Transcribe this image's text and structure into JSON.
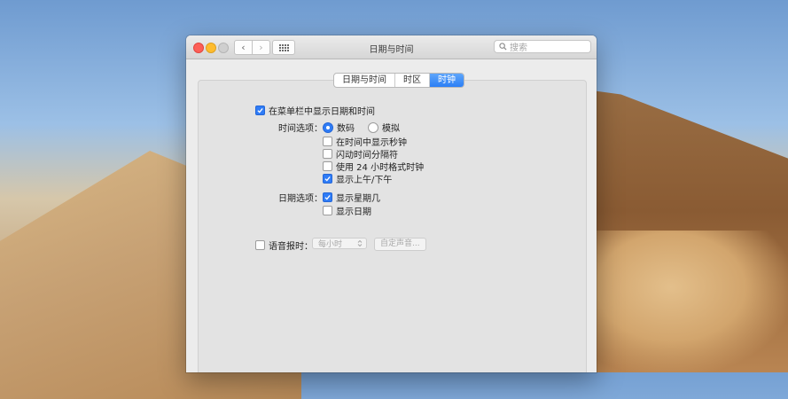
{
  "window": {
    "title": "日期与时间",
    "search_placeholder": "搜索",
    "back_glyph": "‹",
    "forward_glyph": "›"
  },
  "tabs": [
    {
      "label": "日期与时间",
      "active": false
    },
    {
      "label": "时区",
      "active": false
    },
    {
      "label": "时钟",
      "active": true
    }
  ],
  "clock": {
    "show_in_menubar": {
      "label": "在菜单栏中显示日期和时间",
      "checked": true
    },
    "time_options": {
      "label": "时间选项：",
      "digital": {
        "label": "数码",
        "selected": true
      },
      "analog": {
        "label": "模拟",
        "selected": false
      },
      "checkboxes": [
        {
          "label": "在时间中显示秒钟",
          "checked": false
        },
        {
          "label": "闪动时间分隔符",
          "checked": false
        },
        {
          "label": "使用 24 小时格式时钟",
          "checked": false
        },
        {
          "label": "显示上午/下午",
          "checked": true
        }
      ]
    },
    "date_options": {
      "label": "日期选项：",
      "checkboxes": [
        {
          "label": "显示星期几",
          "checked": true
        },
        {
          "label": "显示日期",
          "checked": false
        }
      ]
    },
    "announce": {
      "label": "语音报时：",
      "checked": false,
      "interval_value": "每小时",
      "customize_label": "自定声音..."
    }
  },
  "colors": {
    "accent": "#2f7cf6",
    "close": "#fd5f57",
    "minimize": "#febc2e"
  },
  "icons": [
    "search-icon",
    "chevron-left-icon",
    "chevron-right-icon",
    "grid-icon",
    "checkmark-icon",
    "updown-chevron-icon"
  ]
}
